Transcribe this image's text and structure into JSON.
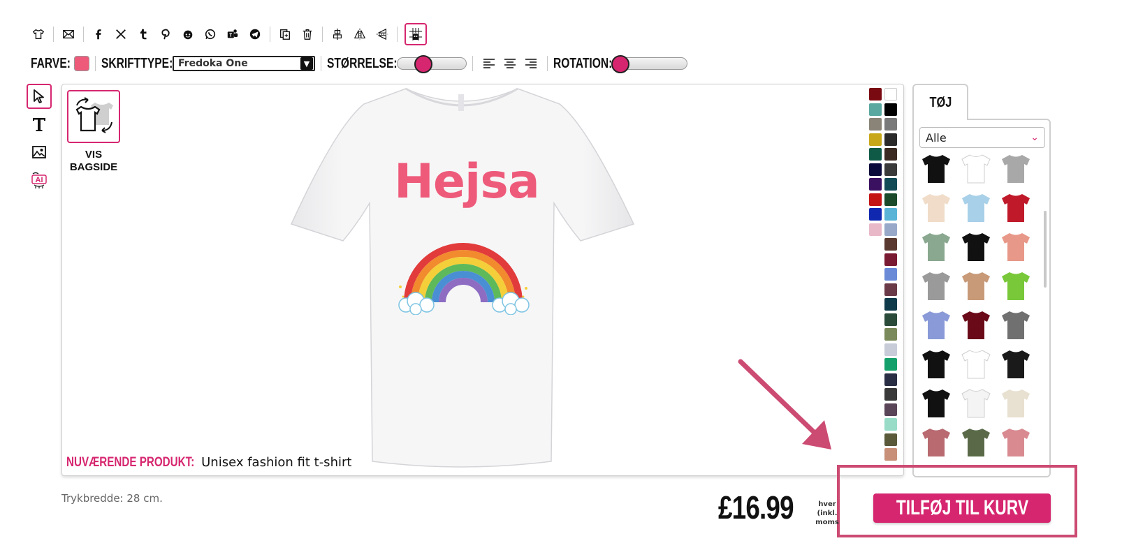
{
  "toolbar": {
    "icons": [
      "tshirt-icon",
      "email-icon",
      "facebook-icon",
      "x-icon",
      "tumblr-icon",
      "pinterest-icon",
      "reddit-icon",
      "whatsapp-icon",
      "teams-icon",
      "telegram-icon",
      "duplicate-icon",
      "trash-icon",
      "center-align-icon",
      "flip-horizontal-icon",
      "flip-vertical-icon",
      "grid-toggle-icon"
    ]
  },
  "format_bar": {
    "color_label": "FARVE:",
    "color_value": "#ee5a7a",
    "font_label": "SKRIFTTYPE:",
    "font_value": "Fredoka One",
    "size_label": "STØRRELSE:",
    "size_value": 0.28,
    "rotation_label": "ROTATION:",
    "rotation_value": 0.0
  },
  "left_tools": [
    "select-tool-icon",
    "text-tool-icon",
    "image-tool-icon",
    "ai-tool-icon"
  ],
  "canvas": {
    "backside_label_line1": "VIS",
    "backside_label_line2": "BAGSIDE",
    "design_text": "Hejsa",
    "current_product_label": "NUVÆRENDE PRODUKT:",
    "current_product_value": "Unisex fashion fit t-shirt"
  },
  "palette": {
    "colors": [
      [
        "#7a0a12",
        "#ffffff"
      ],
      [
        "#5aa8a0",
        "#000000"
      ],
      [
        "#8a8478",
        "#7a7a7a"
      ],
      [
        "#c8a81a",
        "#2a2a2a"
      ],
      [
        "#0e5a46",
        "#3a2a22"
      ],
      [
        "#0a0a3a",
        "#3a3a3a"
      ],
      [
        "#3a1060",
        "#124a56"
      ],
      [
        "#c41414",
        "#1a4a2a"
      ],
      [
        "#1028b0",
        "#5ab4d8"
      ],
      [
        "#e8b8c8",
        "#98a8c8"
      ],
      [
        null,
        "#5a3a30"
      ],
      [
        null,
        "#7a1a32"
      ],
      [
        null,
        "#6a8ad8"
      ],
      [
        null,
        "#6a3a48"
      ],
      [
        null,
        "#0e3a4a"
      ],
      [
        null,
        "#2a4a3a"
      ],
      [
        null,
        "#7a8a5a"
      ],
      [
        null,
        "#c8ccd8"
      ],
      [
        null,
        "#14a06a"
      ],
      [
        null,
        "#2a2e44"
      ],
      [
        null,
        "#3a3a3a"
      ],
      [
        null,
        "#5a4458"
      ],
      [
        null,
        "#98dcc8"
      ],
      [
        null,
        "#5a5a3a"
      ],
      [
        null,
        "#c89078"
      ]
    ]
  },
  "right_panel": {
    "tab_label": "TØJ",
    "category_value": "Alle",
    "items": [
      {
        "name": "black-tshirt",
        "color": "#111111"
      },
      {
        "name": "raglan-baseball-tee",
        "color": "#ffffff"
      },
      {
        "name": "grey-hoodie",
        "color": "#a8a8a8"
      },
      {
        "name": "cream-tshirt",
        "color": "#f0dcc8"
      },
      {
        "name": "tie-dye-blue-tshirt",
        "color": "#a8d0e8"
      },
      {
        "name": "varsity-jacket",
        "color": "#c01a2a"
      },
      {
        "name": "sage-longsleeve",
        "color": "#8aa890"
      },
      {
        "name": "black-orange-hoodie",
        "color": "#111111"
      },
      {
        "name": "pink-tank",
        "color": "#e89888"
      },
      {
        "name": "grey-crop-tee",
        "color": "#9a9a9a"
      },
      {
        "name": "ombre-hoodie",
        "color": "#c89a78"
      },
      {
        "name": "lime-polo",
        "color": "#78c83a"
      },
      {
        "name": "periwinkle-polo",
        "color": "#8a9ad8"
      },
      {
        "name": "maroon-longsleeve",
        "color": "#6a0a18"
      },
      {
        "name": "grey-tshirt",
        "color": "#707070"
      },
      {
        "name": "black-boxy-tee",
        "color": "#111111"
      },
      {
        "name": "white-womens-tee",
        "color": "#ffffff"
      },
      {
        "name": "black-tank",
        "color": "#1a1a1a"
      },
      {
        "name": "black-womens-tee",
        "color": "#111111"
      },
      {
        "name": "white-tank",
        "color": "#f4f4f4"
      },
      {
        "name": "cream-cardigan",
        "color": "#e8e0d0"
      },
      {
        "name": "rose-longsleeve-crop",
        "color": "#b86a70"
      },
      {
        "name": "olive-crop-tank",
        "color": "#5a6a48"
      },
      {
        "name": "rose-tank",
        "color": "#d88a90"
      }
    ]
  },
  "bottom": {
    "trykbredde": "Trykbredde: 28 cm.",
    "price": "£16.99",
    "price_note": "hver (inkl. moms",
    "cart_button": "TILFØJ TIL KURV"
  }
}
